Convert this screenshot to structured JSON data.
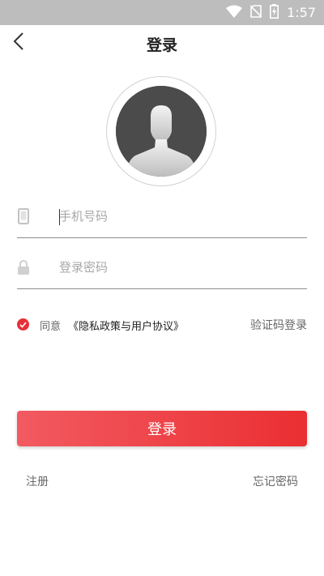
{
  "status_bar": {
    "time": "1:57",
    "icons": [
      "wifi-icon",
      "no-sim-icon",
      "battery-charging-icon"
    ]
  },
  "header": {
    "title": "登录",
    "back_icon": "back-arrow-icon"
  },
  "avatar": {
    "icon": "default-user-avatar"
  },
  "phone_field": {
    "placeholder": "手机号码",
    "value": "",
    "icon": "phone-icon"
  },
  "password_field": {
    "placeholder": "登录密码",
    "value": "",
    "icon": "lock-icon"
  },
  "agreement": {
    "checked": true,
    "prefix": "同意",
    "policy_link": "《隐私政策与用户协议》"
  },
  "code_login_link": "验证码登录",
  "login_button": "登录",
  "register_link": "注册",
  "forgot_password_link": "忘记密码",
  "colors": {
    "accent": "#e5303a",
    "button_start": "#f25a61",
    "button_end": "#ea2f32",
    "status_bar": "#bdbdbd"
  }
}
